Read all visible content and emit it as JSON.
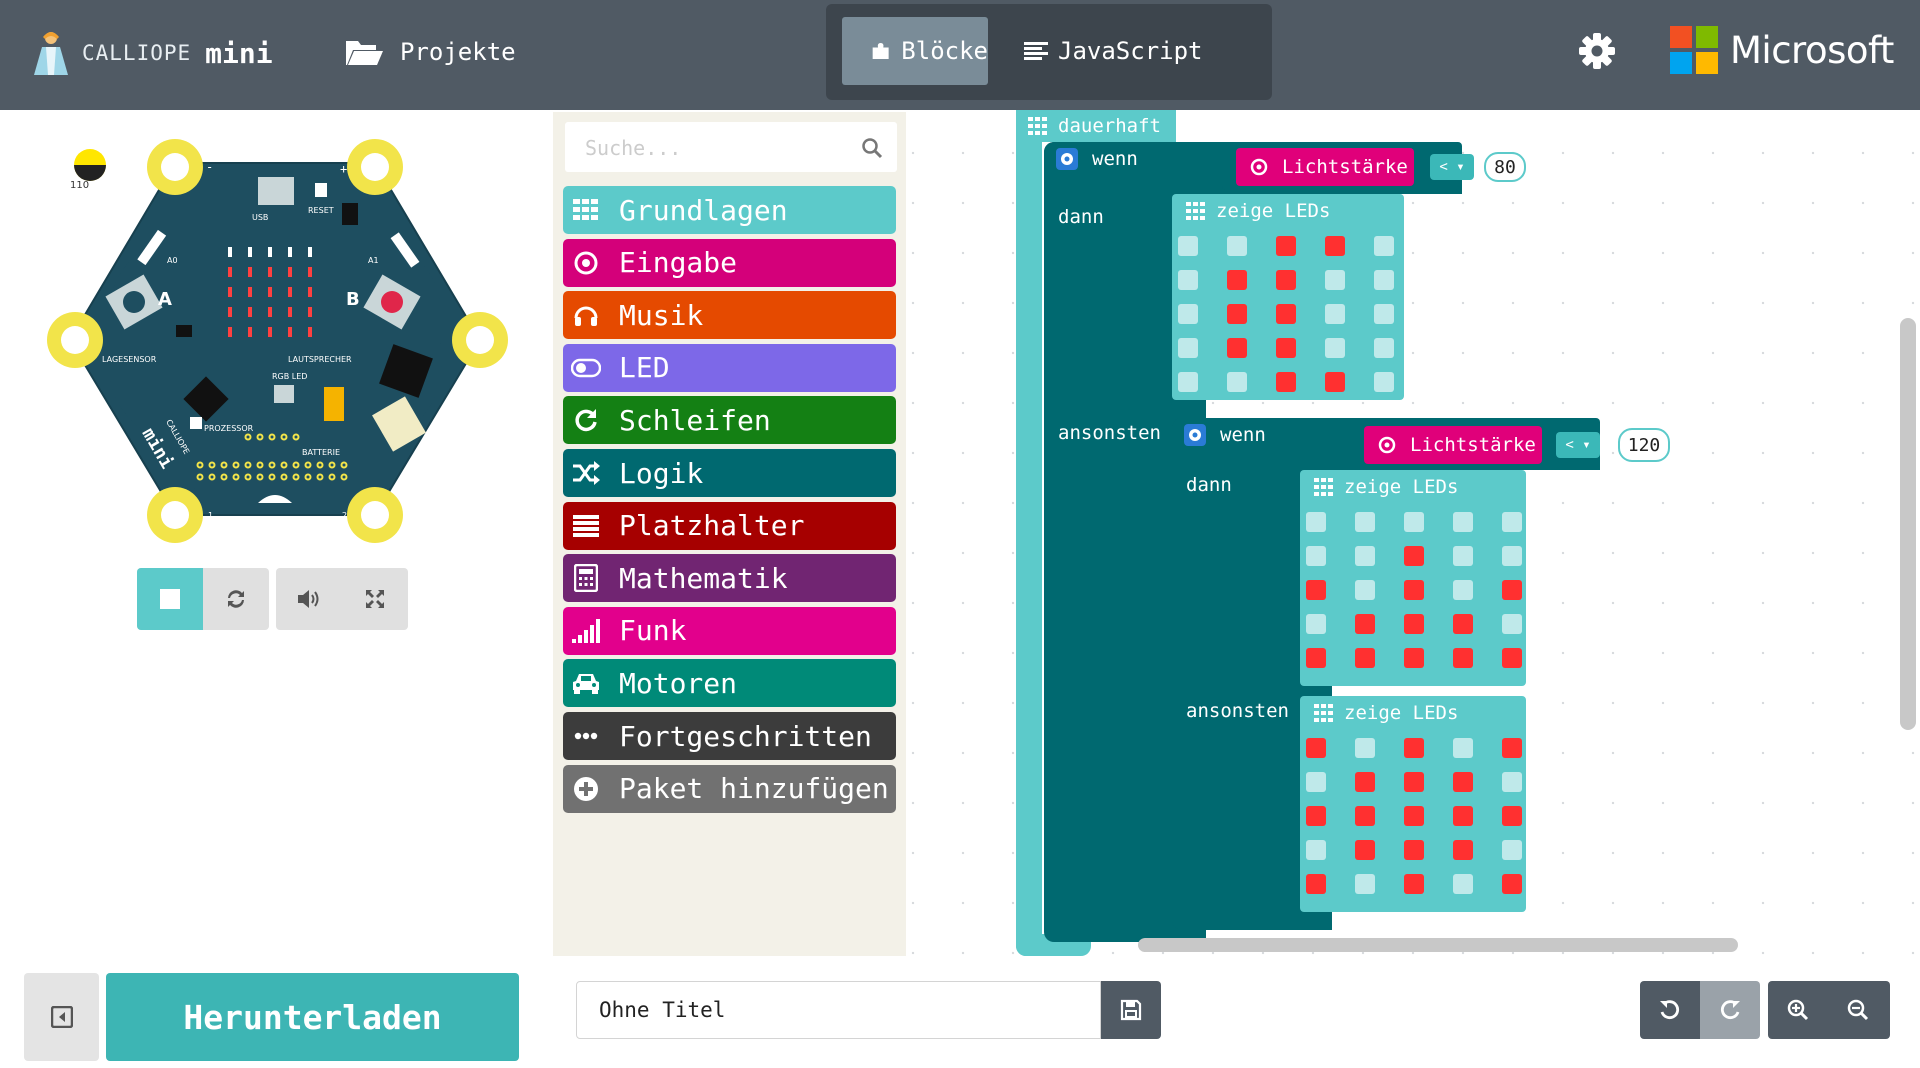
{
  "header": {
    "brand_line1": "CALLIOPE",
    "brand_line2": "mini",
    "projects_label": "Projekte",
    "mode_blocks": "Blöcke",
    "mode_js": "JavaScript",
    "ms_label": "Microsoft",
    "colors": {
      "bar": "#505a64",
      "ms_red": "#f25022",
      "ms_green": "#7fba00",
      "ms_blue": "#00a4ef",
      "ms_yellow": "#ffb900"
    }
  },
  "simulator": {
    "light_value": "110",
    "labels": [
      "USB",
      "RESET",
      "A0",
      "A1",
      "A",
      "B",
      "LAGESENSOR",
      "LAUTSPRECHER",
      "RGB LED",
      "PROZESSOR",
      "BATTERIE",
      "CALLIOPE mini",
      "0",
      "1",
      "2",
      "3",
      "-",
      "+"
    ]
  },
  "toolbox": {
    "search_placeholder": "Suche...",
    "categories": [
      {
        "label": "Grundlagen",
        "color": "#5ccaca",
        "icon": "grid-icon"
      },
      {
        "label": "Eingabe",
        "color": "#d4007a",
        "icon": "target-icon"
      },
      {
        "label": "Musik",
        "color": "#e54a00",
        "icon": "headphones-icon"
      },
      {
        "label": "LED",
        "color": "#7d68e8",
        "icon": "toggle-icon"
      },
      {
        "label": "Schleifen",
        "color": "#148014",
        "icon": "refresh-icon"
      },
      {
        "label": "Logik",
        "color": "#006970",
        "icon": "shuffle-icon"
      },
      {
        "label": "Platzhalter",
        "color": "#a60000",
        "icon": "list-icon"
      },
      {
        "label": "Mathematik",
        "color": "#712572",
        "icon": "calculator-icon"
      },
      {
        "label": "Funk",
        "color": "#e2008c",
        "icon": "signal-icon"
      },
      {
        "label": "Motoren",
        "color": "#008a78",
        "icon": "car-icon"
      },
      {
        "label": "Fortgeschritten",
        "color": "#3c3c3c",
        "icon": "dots-icon"
      },
      {
        "label": "Paket hinzufügen",
        "color": "#717171",
        "icon": "plus-circle-icon"
      }
    ]
  },
  "workspace": {
    "forever_label": "dauerhaft",
    "if_label": "wenn",
    "then_label": "dann",
    "else_label": "ansonsten",
    "show_leds_label": "zeige LEDs",
    "light_label": "Lichtstärke",
    "op_label": "<",
    "value1": "80",
    "value2": "120",
    "grid1": [
      [
        0,
        0,
        1,
        1,
        0
      ],
      [
        0,
        1,
        1,
        0,
        0
      ],
      [
        0,
        1,
        1,
        0,
        0
      ],
      [
        0,
        1,
        1,
        0,
        0
      ],
      [
        0,
        0,
        1,
        1,
        0
      ]
    ],
    "grid2": [
      [
        0,
        0,
        0,
        0,
        0
      ],
      [
        0,
        0,
        1,
        0,
        0
      ],
      [
        1,
        0,
        1,
        0,
        1
      ],
      [
        0,
        1,
        1,
        1,
        0
      ],
      [
        1,
        1,
        1,
        1,
        1
      ]
    ],
    "grid3": [
      [
        1,
        0,
        1,
        0,
        1
      ],
      [
        0,
        1,
        1,
        1,
        0
      ],
      [
        1,
        1,
        1,
        1,
        1
      ],
      [
        0,
        1,
        1,
        1,
        0
      ],
      [
        1,
        0,
        1,
        0,
        1
      ]
    ]
  },
  "footer": {
    "download_label": "Herunterladen",
    "project_title": "Ohne Titel"
  }
}
